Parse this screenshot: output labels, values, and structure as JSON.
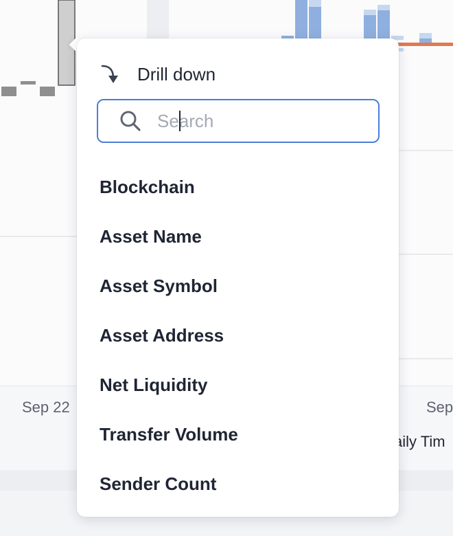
{
  "chart": {
    "x_tick_left": "Sep 22",
    "x_tick_right": "Sep",
    "subtitle_partial": "aily Tim"
  },
  "drilldown": {
    "title": "Drill down",
    "title_icon": "drill-down-arrow-icon",
    "search": {
      "icon": "search-icon",
      "placeholder": "Search",
      "value": ""
    },
    "options": [
      {
        "label": "Blockchain"
      },
      {
        "label": "Asset Name"
      },
      {
        "label": "Asset Symbol"
      },
      {
        "label": "Asset Address"
      },
      {
        "label": "Net Liquidity"
      },
      {
        "label": "Transfer Volume"
      },
      {
        "label": "Sender Count"
      }
    ]
  },
  "colors": {
    "accent_border": "#4a7fd6",
    "bar_blue": "#8fb0de",
    "bar_light_blue": "#c6d8f0",
    "bar_orange": "#e07a4f",
    "bar_gray": "#cfcfcf",
    "text": "#1f2533"
  }
}
